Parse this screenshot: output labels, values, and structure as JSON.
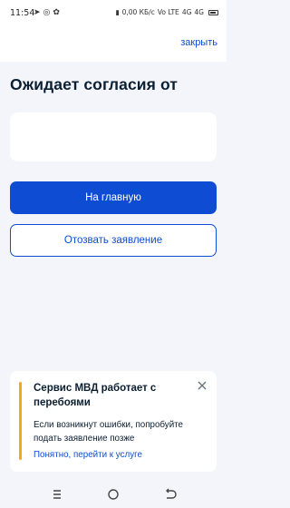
{
  "status_bar": {
    "time": "11:54",
    "left_icons": [
      "location-icon",
      "whatsapp-icon",
      "settings-icon"
    ],
    "right_text": [
      "0,00 КБ/с",
      "Vo LTE",
      "4G",
      "4G"
    ]
  },
  "header": {
    "close_label": "закрыть"
  },
  "main": {
    "title": "Ожидает согласия от",
    "primary_button": "На главную",
    "secondary_button": "Отозвать заявление"
  },
  "notice": {
    "title": "Сервис МВД работает с перебоями",
    "body": "Если возникнут ошибки, попробуйте подать заявление позже",
    "link": "Понятно, перейти к услуге",
    "accent_color": "#f5a623"
  },
  "nav": {
    "items": [
      "menu-icon",
      "home-icon",
      "back-icon"
    ]
  },
  "colors": {
    "primary": "#0d4cd3",
    "background": "#f3f5fa",
    "text": "#0b1f33"
  }
}
